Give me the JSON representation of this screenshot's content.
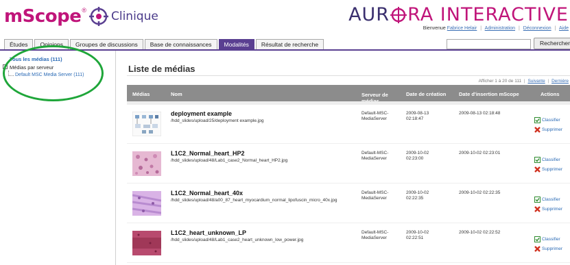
{
  "header": {
    "logo_main": "mScope",
    "logo_reg": "®",
    "logo_sub": "Clinique",
    "brand_left": "AUR",
    "brand_right": "RA INTERACTIVE",
    "welcome_text": "Bienvenue",
    "user_name": "Fabrice Helair",
    "link_admin": "Administration",
    "link_logout": "Déconnexion",
    "link_help": "Aide"
  },
  "tabs": [
    {
      "label": "Études",
      "active": false
    },
    {
      "label": "Opinions",
      "active": false
    },
    {
      "label": "Groupes de discussions",
      "active": false
    },
    {
      "label": "Base de connaissances",
      "active": false
    },
    {
      "label": "Modalités",
      "active": true
    },
    {
      "label": "Résultat de recherche",
      "active": false
    }
  ],
  "search": {
    "value": "",
    "button_label": "Rechercher"
  },
  "sidebar": {
    "all_media": "Tous les médias (111)",
    "toggle": "−",
    "by_server": "Médias par serveur",
    "server_item": "Default MSC Media Server (111)"
  },
  "main": {
    "title": "Liste de médias",
    "pager_text": "Afficher 1 à 20 de 111",
    "pager_next": "Suivante",
    "pager_last": "Dernière"
  },
  "table": {
    "headers": {
      "media": "Médias",
      "name": "Nom",
      "server": "Serveur de médias",
      "created": "Date de création",
      "inserted": "Date d'insertion mScope",
      "actions": "Actions"
    },
    "rows": [
      {
        "name": "deployment example",
        "path": "/hdd_slides/upload/25/deployment example.jpg",
        "server": "Default-MSC-MediaServer",
        "created": "2009-08-13 02:18:47",
        "inserted": "2009-08-13 02:18:48",
        "classify": "Classifier",
        "delete": "Supprimer"
      },
      {
        "name": "L1C2_Normal_heart_HP2",
        "path": "/hdd_slides/upload/48/Lab1_case2_Normal_heart_HP2.jpg",
        "server": "Default-MSC-MediaServer",
        "created": "2009-10-02 02:23:00",
        "inserted": "2009-10-02 02:23:01",
        "classify": "Classifier",
        "delete": "Supprimer"
      },
      {
        "name": "L1C2_Normal_heart_40x",
        "path": "/hdd_slides/upload/48/a00_87_heart_myocardium_normal_lipofuscin_micro_40x.jpg",
        "server": "Default-MSC-MediaServer",
        "created": "2009-10-02 02:22:35",
        "inserted": "2009-10-02 02:22:35",
        "classify": "Classifier",
        "delete": "Supprimer"
      },
      {
        "name": "L1C2_heart_unknown_LP",
        "path": "/hdd_slides/upload/48/Lab1_case2_heart_unknown_low_power.jpg",
        "server": "Default-MSC-MediaServer",
        "created": "2009-10-02 02:22:51",
        "inserted": "2009-10-02 02:22:52",
        "classify": "Classifier",
        "delete": "Supprimer"
      }
    ]
  },
  "colors": {
    "brand_magenta": "#c0157a",
    "brand_purple": "#5a3f91",
    "link_blue": "#2a6ab5",
    "header_gray": "#8c8c8c",
    "annotation_green": "#1fa63a"
  }
}
